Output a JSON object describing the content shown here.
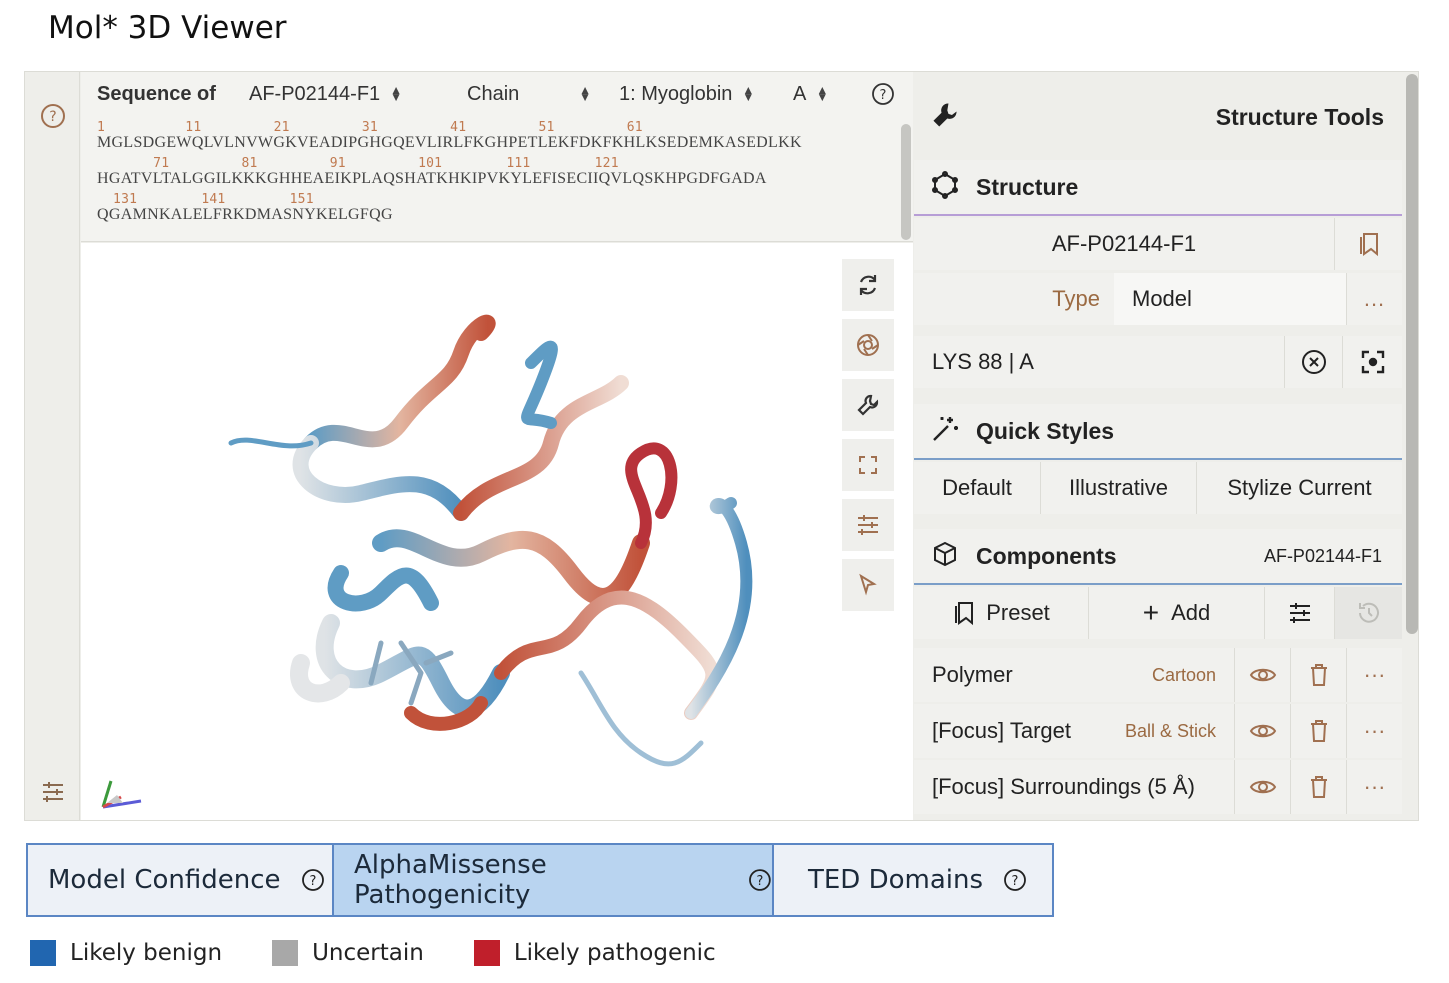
{
  "page": {
    "title": "Mol* 3D Viewer"
  },
  "sequence": {
    "label": "Sequence of",
    "entry_select": "AF-P02144-F1",
    "mode_select": "Chain",
    "entity_select": "1: Myoglobin",
    "chain_select": "A",
    "lines": [
      {
        "nums": "1          11         21         31         41         51         61",
        "seq": "MGLSDGEWQLVLNVWGKVEADIPGHGQEVLIRLFKGHPETLEKFDKFKHLKSEDEMKASEDLKK"
      },
      {
        "nums": "       71         81         91         101        111        121",
        "seq": "HGATVLTALGGILKKKGHHEAEIKPLAQSHATKHKIPVKYLEFISECIIQVLQSKHPGDFGADA"
      },
      {
        "nums": "  131        141        151",
        "seq": "QGAMNKALELFRKDMASNYKELGFQG"
      }
    ]
  },
  "viewport": {
    "tool_icons": [
      "reset-camera-icon",
      "screenshot-icon",
      "wrench-icon",
      "fullscreen-icon",
      "settings-sliders-icon",
      "selection-mode-icon"
    ]
  },
  "structure_tools": {
    "title": "Structure Tools",
    "structure": {
      "heading": "Structure",
      "entry": "AF-P02144-F1",
      "type_label": "Type",
      "type_value": "Model",
      "more": "..."
    },
    "focus": {
      "label": "LYS 88 | A"
    },
    "quick_styles": {
      "heading": "Quick Styles",
      "buttons": [
        "Default",
        "Illustrative",
        "Stylize Current"
      ]
    },
    "components": {
      "heading": "Components",
      "entry": "AF-P02144-F1",
      "preset_label": "Preset",
      "add_label": "Add",
      "items": [
        {
          "name": "Polymer",
          "repr": "Cartoon"
        },
        {
          "name": "[Focus] Target",
          "repr": "Ball & Stick"
        },
        {
          "name": "[Focus] Surroundings (5 Å)",
          "repr": ""
        }
      ]
    }
  },
  "tabs": [
    {
      "label": "Model Confidence",
      "active": false
    },
    {
      "label": "AlphaMissense Pathogenicity",
      "active": true
    },
    {
      "label": "TED Domains",
      "active": false
    }
  ],
  "legend": [
    {
      "label": "Likely benign",
      "color": "#2166b0"
    },
    {
      "label": "Uncertain",
      "color": "#a8a8a8"
    },
    {
      "label": "Likely pathogenic",
      "color": "#c01f2b"
    }
  ],
  "colors": {
    "accent_blue": "#5b86c4",
    "active_tab": "#b9d4f0",
    "rep_text": "#9b6a42",
    "seq_num": "#c07a50"
  }
}
